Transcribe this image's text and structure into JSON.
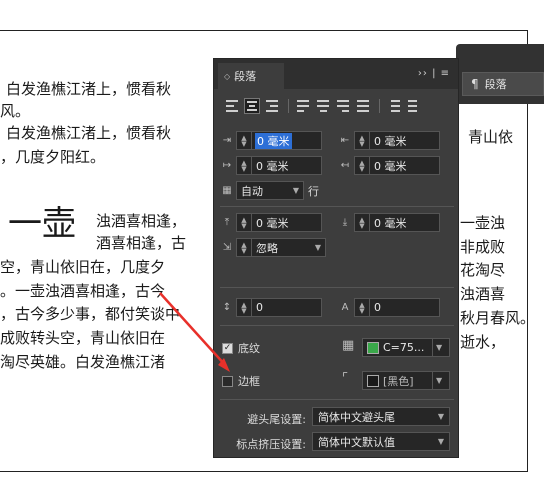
{
  "document": {
    "lines": [
      "白发渔樵江渚上，惯看秋",
      "风。",
      "白发渔樵江渚上，惯看秋",
      "，几度夕阳红。",
      "浊酒喜相逢，",
      "酒喜相逢，古",
      "空，青山依旧在，几度夕",
      "。一壶浊酒喜相逢，古今",
      "，古今多少事，都付笑谈中",
      "成败转头空，青山依旧在",
      "淘尽英雄。白发渔樵江渚"
    ],
    "right_lines": [
      "青山依",
      "一壶浊",
      "非成败",
      "花淘尽",
      "浊酒喜",
      "秋月春风。",
      "逝水，"
    ],
    "big_char": "一壶"
  },
  "dock": {
    "tab_icon": "¶",
    "tab_label": "段落"
  },
  "panel": {
    "title": "段落",
    "header_icons": "›› | ≡",
    "left_indent": "0 毫米",
    "right_indent": "0 毫米",
    "first_line_indent": "0 毫米",
    "last_line_indent": "0 毫米",
    "autoleading": "自动",
    "leading_unit": "行",
    "space_before": "0 毫米",
    "space_after": "0 毫米",
    "drop_cap": "忽略",
    "drop_cap_lines": "0",
    "drop_cap_chars": "0",
    "shading_label": "底纹",
    "shading_checked": true,
    "shading_color": "C=75...",
    "shading_swatch": "#3aa84a",
    "border_label": "边框",
    "border_checked": false,
    "border_color": "[黑色]",
    "border_swatch": "#1a1a1a",
    "kinsoku_label": "避头尾设置:",
    "kinsoku_value": "简体中文避头尾",
    "mojikumi_label": "标点挤压设置:",
    "mojikumi_value": "简体中文默认值"
  },
  "colors": {
    "panel_bg": "#3d3d3d",
    "highlight": "#2d6fd6",
    "arrow": "#e8302a"
  }
}
